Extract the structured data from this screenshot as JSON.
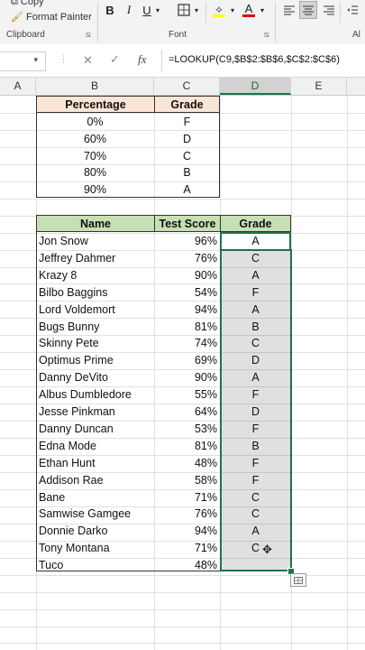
{
  "ribbon": {
    "copy_label": "Copy",
    "format_painter_label": "Format Painter",
    "clipboard_label": "Clipboard",
    "font_label": "Font",
    "bold": "B",
    "italic": "I",
    "underline": "U",
    "font_color_letter": "A",
    "trailing_label": "Al"
  },
  "formula_bar": {
    "formula": "=LOOKUP(C9,$B$2:$B$6,$C$2:$C$6)",
    "cancel_symbol": "✕",
    "enter_symbol": "✓",
    "fx_label": "fx"
  },
  "columns": [
    "A",
    "B",
    "C",
    "D",
    "E"
  ],
  "lookup_table": {
    "headers": [
      "Percentage",
      "Grade"
    ],
    "rows": [
      [
        "0%",
        "F"
      ],
      [
        "60%",
        "D"
      ],
      [
        "70%",
        "C"
      ],
      [
        "80%",
        "B"
      ],
      [
        "90%",
        "A"
      ]
    ],
    "header_color": "#fbe5d6"
  },
  "scores_table": {
    "headers": [
      "Name",
      "Test Score",
      "Grade"
    ],
    "header_color": "#c6e0b4",
    "rows": [
      [
        "Jon Snow",
        "96%",
        "A"
      ],
      [
        "Jeffrey Dahmer",
        "76%",
        "C"
      ],
      [
        "Krazy 8",
        "90%",
        "A"
      ],
      [
        "Bilbo Baggins",
        "54%",
        "F"
      ],
      [
        "Lord Voldemort",
        "94%",
        "A"
      ],
      [
        "Bugs Bunny",
        "81%",
        "B"
      ],
      [
        "Skinny Pete",
        "74%",
        "C"
      ],
      [
        "Optimus Prime",
        "69%",
        "D"
      ],
      [
        "Danny DeVito",
        "90%",
        "A"
      ],
      [
        "Albus Dumbledore",
        "55%",
        "F"
      ],
      [
        "Jesse Pinkman",
        "64%",
        "D"
      ],
      [
        "Danny Duncan",
        "53%",
        "F"
      ],
      [
        "Edna Mode",
        "81%",
        "B"
      ],
      [
        "Ethan Hunt",
        "48%",
        "F"
      ],
      [
        "Addison Rae",
        "58%",
        "F"
      ],
      [
        "Bane",
        "71%",
        "C"
      ],
      [
        "Samwise Gamgee",
        "76%",
        "C"
      ],
      [
        "Donnie Darko",
        "94%",
        "A"
      ],
      [
        "Tony Montana",
        "71%",
        "C"
      ],
      [
        "Tuco",
        "48%",
        ""
      ]
    ]
  },
  "accent_color": "#217346"
}
